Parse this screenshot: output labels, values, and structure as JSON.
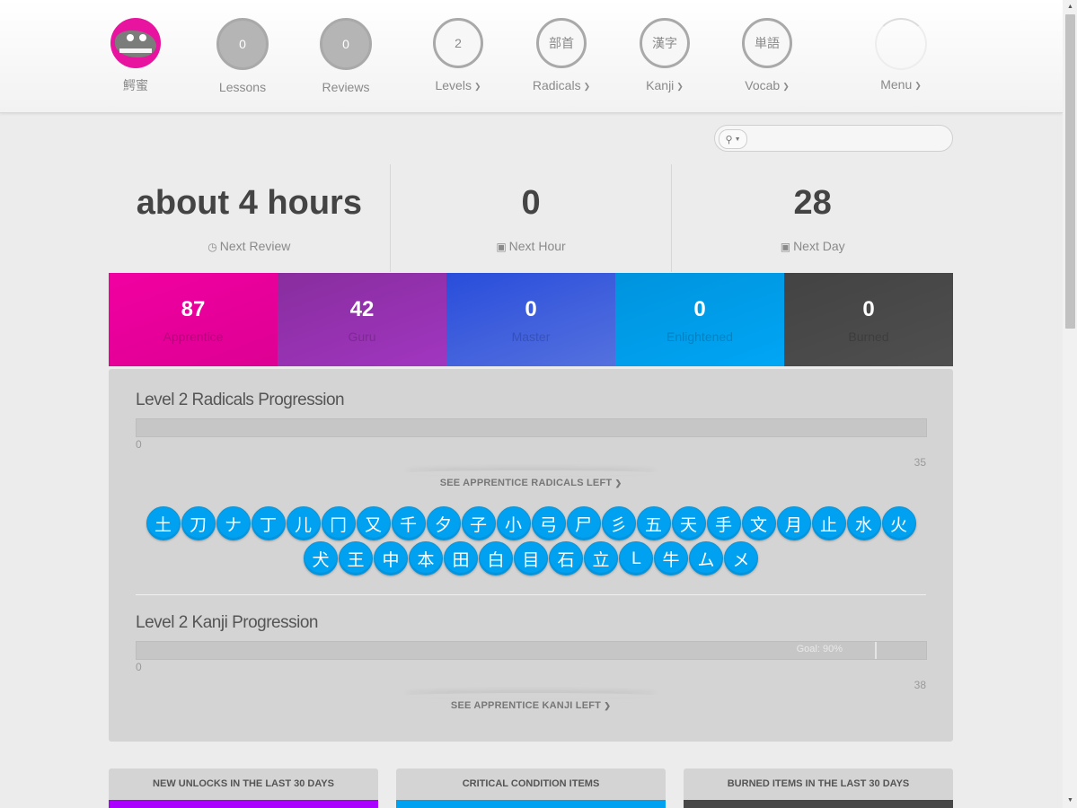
{
  "nav": {
    "user": {
      "name": "鰐蜜"
    },
    "lessons": {
      "count": "0",
      "label": "Lessons"
    },
    "reviews": {
      "count": "0",
      "label": "Reviews"
    },
    "levels": {
      "value": "2",
      "label": "Levels"
    },
    "radicals": {
      "glyph": "部首",
      "label": "Radicals"
    },
    "kanji": {
      "glyph": "漢字",
      "label": "Kanji"
    },
    "vocab": {
      "glyph": "単語",
      "label": "Vocab"
    },
    "menu": {
      "label": "Menu"
    }
  },
  "search": {
    "placeholder": "",
    "icon": "search-icon"
  },
  "stats": [
    {
      "value": "about 4 hours",
      "label": "Next Review",
      "icon": "clock-icon"
    },
    {
      "value": "0",
      "label": "Next Hour",
      "icon": "inbox-icon"
    },
    {
      "value": "28",
      "label": "Next Day",
      "icon": "inbox-icon"
    }
  ],
  "srs": [
    {
      "count": "87",
      "label": "Apprentice",
      "color": "#f100a1"
    },
    {
      "count": "42",
      "label": "Guru",
      "color": "#9c34b8"
    },
    {
      "count": "0",
      "label": "Master",
      "color": "#3d5ad8"
    },
    {
      "count": "0",
      "label": "Enlightened",
      "color": "#00a1f1"
    },
    {
      "count": "0",
      "label": "Burned",
      "color": "#474747"
    }
  ],
  "radicals_progression": {
    "title": "Level 2 Radicals Progression",
    "min": "0",
    "max": "35",
    "progress": 0,
    "see_label": "SEE APPRENTICE RADICALS LEFT",
    "items_row1": [
      "土",
      "刀",
      "ナ",
      "丁",
      "儿",
      "冂",
      "又",
      "千",
      "夕",
      "子",
      "小",
      "弓",
      "尸",
      "彡",
      "五",
      "天",
      "手",
      "文",
      "月",
      "止",
      "水",
      "火"
    ],
    "items_row2": [
      "犬",
      "王",
      "中",
      "本",
      "田",
      "白",
      "目",
      "石",
      "立",
      "L",
      "牛",
      "ム",
      "メ"
    ]
  },
  "kanji_progression": {
    "title": "Level 2 Kanji Progression",
    "min": "0",
    "max": "38",
    "progress": 0,
    "goal_label": "Goal: 90%",
    "see_label": "SEE APPRENTICE KANJI LEFT"
  },
  "cards": [
    {
      "title": "NEW UNLOCKS IN THE LAST 30 DAYS",
      "color": "#aa00ff"
    },
    {
      "title": "CRITICAL CONDITION ITEMS",
      "color": "#00a1f1"
    },
    {
      "title": "BURNED ITEMS IN THE LAST 30 DAYS",
      "color": "#474747"
    }
  ]
}
